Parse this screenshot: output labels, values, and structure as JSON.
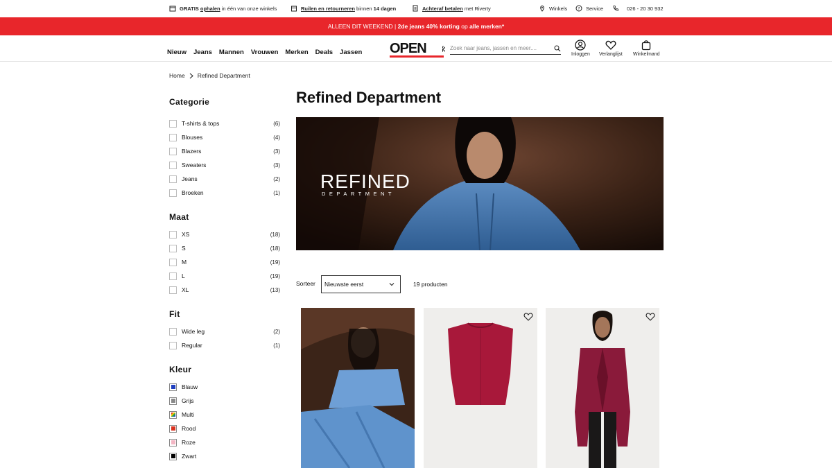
{
  "utility": {
    "pickup_a": "GRATIS",
    "pickup_b": "ophalen",
    "pickup_c": "in één van onze winkels",
    "returns_a": "Ruilen en retourneren",
    "returns_b": "binnen",
    "returns_c": "14 dagen",
    "pay_a": "Achteraf betalen",
    "pay_b": "met Riverty",
    "stores": "Winkels",
    "service": "Service",
    "phone": "026 - 20 30 932"
  },
  "promo": {
    "part1": "ALLEEN DIT WEEKEND | ",
    "part2": "2de jeans 40% korting",
    "part3": " op ",
    "part4": "alle merken*"
  },
  "header": {
    "nav": [
      "Nieuw",
      "Jeans",
      "Mannen",
      "Vrouwen",
      "Merken",
      "Deals",
      "Jassen"
    ],
    "search_placeholder": "Zoek naar jeans, jassen en meer....",
    "login": "Inloggen",
    "wishlist": "Verlanglijst",
    "cart": "Winkelmand"
  },
  "breadcrumb": {
    "home": "Home",
    "current": "Refined Department"
  },
  "filters": {
    "categorie": {
      "title": "Categorie",
      "items": [
        {
          "label": "T-shirts & tops",
          "count": "(6)"
        },
        {
          "label": "Blouses",
          "count": "(4)"
        },
        {
          "label": "Blazers",
          "count": "(3)"
        },
        {
          "label": "Sweaters",
          "count": "(3)"
        },
        {
          "label": "Jeans",
          "count": "(2)"
        },
        {
          "label": "Broeken",
          "count": "(1)"
        }
      ]
    },
    "maat": {
      "title": "Maat",
      "items": [
        {
          "label": "XS",
          "count": "(18)"
        },
        {
          "label": "S",
          "count": "(18)"
        },
        {
          "label": "M",
          "count": "(19)"
        },
        {
          "label": "L",
          "count": "(19)"
        },
        {
          "label": "XL",
          "count": "(13)"
        }
      ]
    },
    "fit": {
      "title": "Fit",
      "items": [
        {
          "label": "Wide leg",
          "count": "(2)"
        },
        {
          "label": "Regular",
          "count": "(1)"
        }
      ]
    },
    "kleur": {
      "title": "Kleur",
      "items": [
        {
          "label": "Blauw",
          "color": "#1f3fbf"
        },
        {
          "label": "Grijs",
          "color": "#8a8a8a"
        },
        {
          "label": "Multi",
          "color": "multi"
        },
        {
          "label": "Rood",
          "color": "#d9321f"
        },
        {
          "label": "Roze",
          "color": "#f3b6c4"
        },
        {
          "label": "Zwart",
          "color": "#000000"
        }
      ]
    }
  },
  "main": {
    "title": "Refined Department",
    "banner_word": "REFINED",
    "banner_sub": "DEPARTMENT",
    "sort_label": "Sorteer",
    "sort_value": "Nieuwste eerst",
    "product_count": "19 producten"
  },
  "colors": {
    "promo": "#e8262b",
    "accent": "#e8262b"
  }
}
